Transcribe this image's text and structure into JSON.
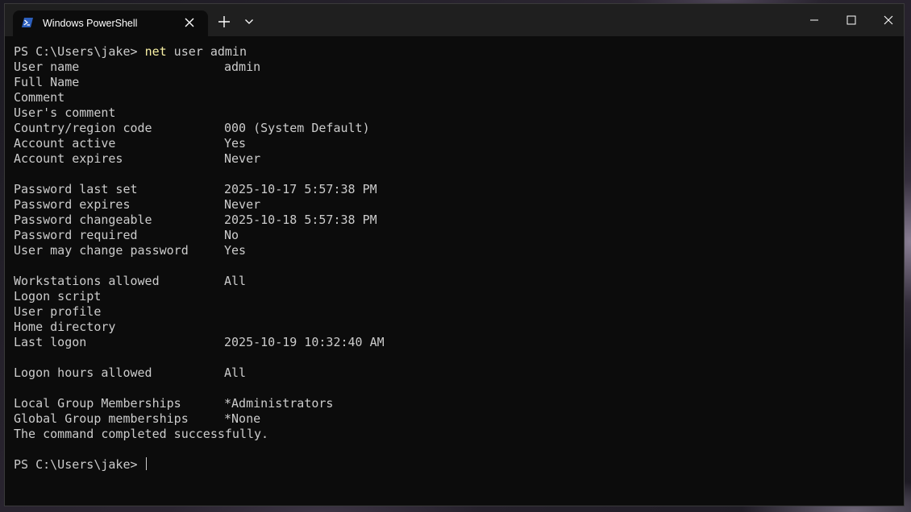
{
  "window": {
    "tab_title": "Windows PowerShell",
    "tab_icon": "powershell-icon",
    "controls": [
      "minimize-icon",
      "maximize-icon",
      "close-icon"
    ]
  },
  "terminal": {
    "prompt": "PS C:\\Users\\jake> ",
    "command_name": "net",
    "command_args": " user admin",
    "info1": [
      {
        "label": "User name",
        "value": "admin"
      },
      {
        "label": "Full Name",
        "value": ""
      },
      {
        "label": "Comment",
        "value": ""
      },
      {
        "label": "User's comment",
        "value": ""
      },
      {
        "label": "Country/region code",
        "value": "000 (System Default)"
      },
      {
        "label": "Account active",
        "value": "Yes"
      },
      {
        "label": "Account expires",
        "value": "Never"
      }
    ],
    "info2": [
      {
        "label": "Password last set",
        "value": "2025-10-17 5:57:38 PM"
      },
      {
        "label": "Password expires",
        "value": "Never"
      },
      {
        "label": "Password changeable",
        "value": "2025-10-18 5:57:38 PM"
      },
      {
        "label": "Password required",
        "value": "No"
      },
      {
        "label": "User may change password",
        "value": "Yes"
      }
    ],
    "info3": [
      {
        "label": "Workstations allowed",
        "value": "All"
      },
      {
        "label": "Logon script",
        "value": ""
      },
      {
        "label": "User profile",
        "value": ""
      },
      {
        "label": "Home directory",
        "value": ""
      },
      {
        "label": "Last logon",
        "value": "2025-10-19 10:32:40 AM"
      }
    ],
    "info4": [
      {
        "label": "Logon hours allowed",
        "value": "All"
      }
    ],
    "info5": [
      {
        "label": "Local Group Memberships",
        "value": "*Administrators"
      },
      {
        "label": "Global Group memberships",
        "value": "*None"
      }
    ],
    "completion": "The command completed successfully.",
    "prompt2": "PS C:\\Users\\jake> "
  }
}
